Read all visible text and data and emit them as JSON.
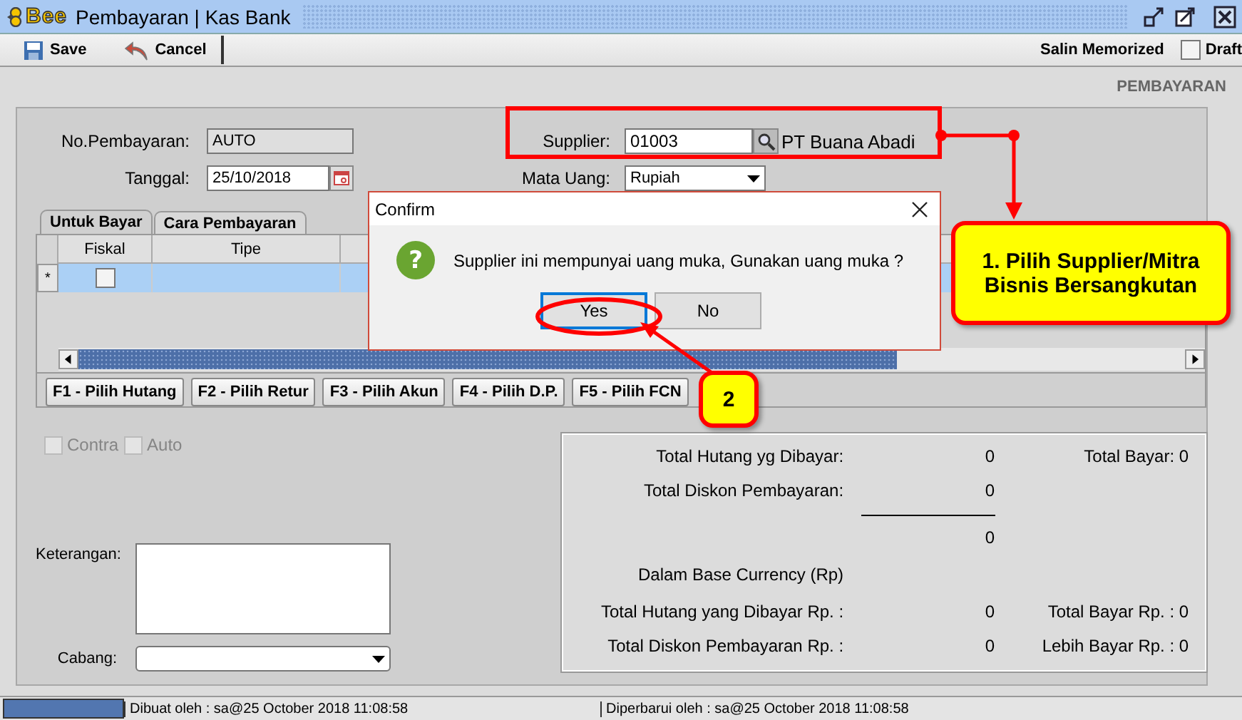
{
  "window": {
    "logo": "Bee",
    "title": "Pembayaran | Kas Bank"
  },
  "toolbar": {
    "buttons": [
      {
        "label": "Save"
      },
      {
        "label": "Cancel"
      }
    ],
    "memorized": "Salin Memorized",
    "draft": {
      "label": "Draft",
      "checked": false
    }
  },
  "section_title": "PEMBAYARAN",
  "form": {
    "no_pembayaran": {
      "label": "No.Pembayaran:",
      "value": "AUTO"
    },
    "tanggal": {
      "label": "Tanggal:",
      "value": "25/10/2018"
    },
    "supplier": {
      "label": "Supplier:",
      "value": "01003",
      "name": "PT Buana Abadi"
    },
    "mata_uang": {
      "label": "Mata Uang:",
      "value": "Rupiah"
    }
  },
  "tabs": [
    {
      "label": "Untuk Bayar",
      "selected": true
    },
    {
      "label": "Cara Pembayaran",
      "selected": false
    }
  ],
  "table": {
    "columns": [
      "Fiskal",
      "Tipe"
    ],
    "rows": [
      {
        "marker": "*",
        "fiskal_checked": false,
        "selected": true
      }
    ]
  },
  "function_buttons": [
    "F1 - Pilih Hutang",
    "F2 - Pilih Retur",
    "F3 - Pilih Akun",
    "F4 - Pilih D.P.",
    "F5 - Pilih FCN"
  ],
  "options": [
    {
      "label": "Contra",
      "checked": false,
      "disabled": true
    },
    {
      "label": "Auto",
      "checked": false,
      "disabled": true
    }
  ],
  "keterangan": {
    "label": "Keterangan:"
  },
  "cabang": {
    "label": "Cabang:"
  },
  "totals": [
    {
      "kind": "line",
      "label": "Total Hutang yg Dibayar:",
      "value": "0",
      "side": "Total Bayar: 0"
    },
    {
      "kind": "line",
      "label": "Total Diskon Pembayaran:",
      "value": "0"
    },
    {
      "kind": "sum",
      "value": "0"
    },
    {
      "kind": "heading",
      "label": "Dalam Base Currency (Rp)"
    },
    {
      "kind": "line",
      "label": "Total Hutang yang Dibayar Rp. :",
      "value": "0",
      "side": "Total Bayar Rp. : 0"
    },
    {
      "kind": "line",
      "label": "Total Diskon Pembayaran Rp. :",
      "value": "0",
      "side": "Lebih Bayar Rp. : 0"
    }
  ],
  "status_bar": {
    "created": "Dibuat oleh : sa@25 October 2018  11:08:58",
    "updated": "Diperbarui oleh : sa@25 October 2018  11:08:58"
  },
  "dialog": {
    "title": "Confirm",
    "icon": "?",
    "message": "Supplier ini mempunyai uang muka, Gunakan uang muka ?",
    "buttons": [
      {
        "label": "Yes",
        "selected": true
      },
      {
        "label": "No",
        "selected": false
      }
    ]
  },
  "annotations": [
    {
      "text": "1. Pilih Supplier/Mitra Bisnis Bersangkutan"
    },
    {
      "text": "2"
    }
  ]
}
